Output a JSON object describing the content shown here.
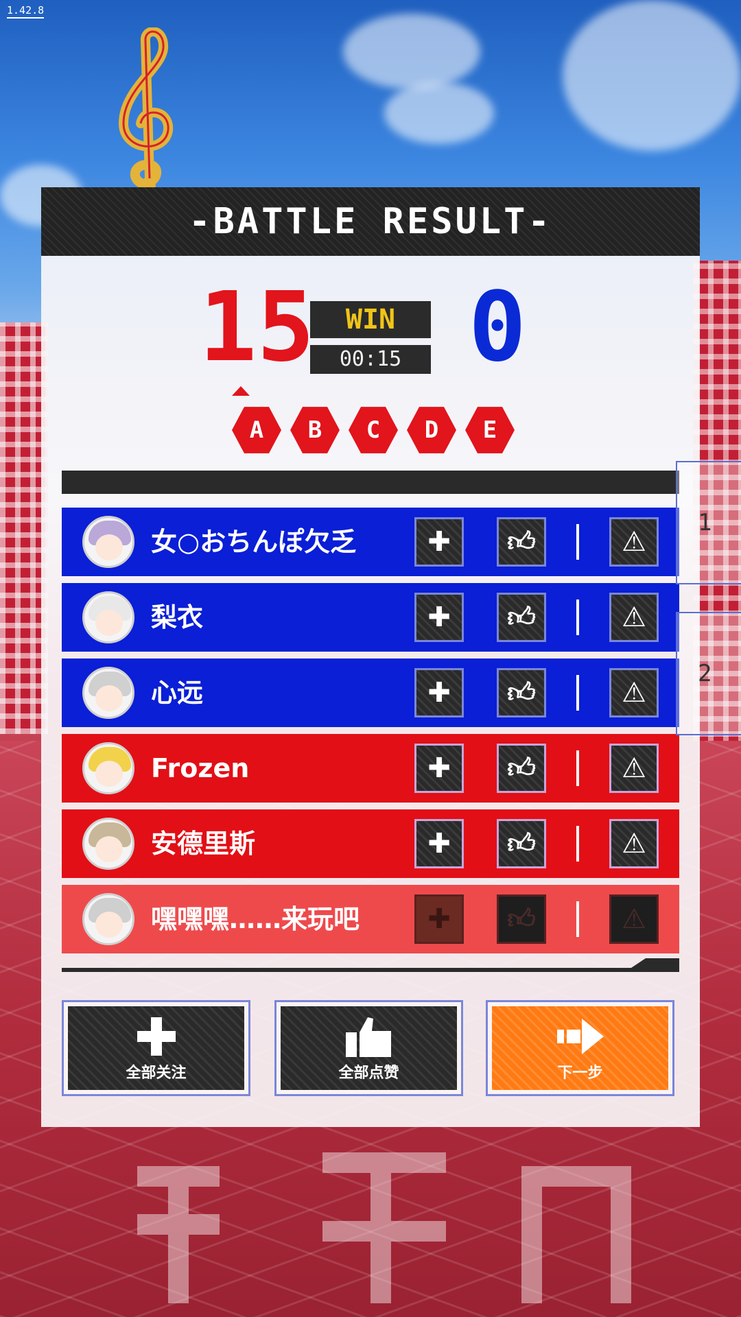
{
  "version": "1.42.8",
  "panel": {
    "title": "-BATTLE RESULT-"
  },
  "score": {
    "left": "15",
    "right": "0",
    "result": "WIN",
    "time": "00:15"
  },
  "grades": [
    "A",
    "B",
    "C",
    "D",
    "E"
  ],
  "players": [
    {
      "name": "女○おちんぽ欠乏",
      "team": "blue",
      "hair": "#b9a8d8"
    },
    {
      "name": "梨衣",
      "team": "blue",
      "hair": "#e8e8e8"
    },
    {
      "name": "心远",
      "team": "blue",
      "hair": "#d0d0d0"
    },
    {
      "name": "Frozen",
      "team": "red",
      "hair": "#f2d24a"
    },
    {
      "name": "安德里斯",
      "team": "red",
      "hair": "#c9b79a"
    },
    {
      "name": "嘿嘿嘿……来玩吧",
      "team": "red-dim",
      "hair": "#cfcfcf"
    }
  ],
  "side_tabs": [
    "1",
    "2"
  ],
  "actions": {
    "follow_all": "全部关注",
    "like_all": "全部点赞",
    "next": "下一步"
  },
  "icons": {
    "follow": "plus-icon",
    "like": "thumbs-up-icon",
    "report": "warning-icon",
    "next": "arrow-right-icon"
  },
  "colors": {
    "blue_team": "#0a1fd6",
    "red_team": "#e20f16",
    "win": "#f0c419",
    "next_button": "#ff7a12"
  }
}
